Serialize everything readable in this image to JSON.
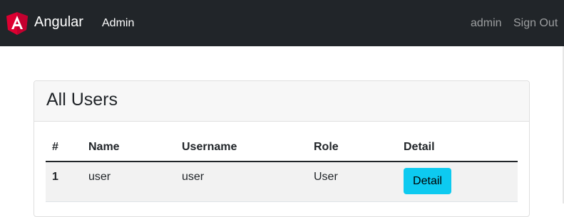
{
  "navbar": {
    "brand": "Angular",
    "admin_link": "Admin",
    "user_link": "admin",
    "signout_link": "Sign Out",
    "logo_icon": "angular-logo-icon",
    "logo_color": "#dd0031"
  },
  "card": {
    "title": "All Users"
  },
  "table": {
    "columns": [
      "#",
      "Name",
      "Username",
      "Role",
      "Detail"
    ],
    "rows": [
      {
        "index": "1",
        "name": "user",
        "username": "user",
        "role": "User",
        "detail_label": "Detail"
      }
    ]
  },
  "colors": {
    "navbar_bg": "#212529",
    "info_button": "#0dcaf0"
  }
}
